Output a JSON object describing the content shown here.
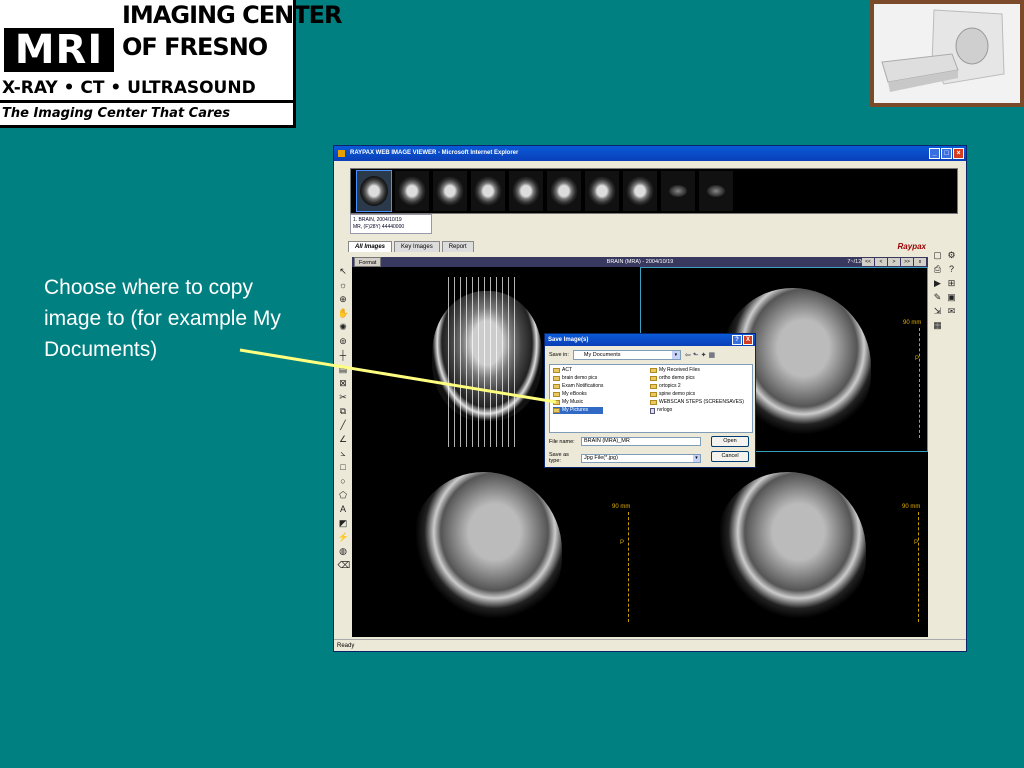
{
  "logo": {
    "mri": "MRI",
    "line1": "IMAGING CENTER",
    "line2": "OF FRESNO",
    "services": "X-RAY • CT • ULTRASOUND",
    "tagline": "The Imaging Center That Cares"
  },
  "caption": "Choose where to copy image to (for example My Documents)",
  "browser": {
    "title": "RAYPAX WEB IMAGE VIEWER - Microsoft Internet Explorer",
    "thumb_caption_line1": "1. BRAIN, 2004/10/19",
    "thumb_caption_line2": "MR, (F)28Y) 44440000",
    "tabs": [
      "All Images",
      "Key Images",
      "Report"
    ],
    "brand": "Raypax",
    "format_button": "Format",
    "viewer_title": "BRAIN (MRA) - 2004/10/19",
    "page_indicator": "7~/12(1)",
    "nav": [
      "<<",
      "<",
      ">",
      ">>",
      "x"
    ],
    "scale_label": "90 mm",
    "orientation_p": "P",
    "status": "Ready"
  },
  "dialog": {
    "title": "Save Image(s)",
    "help": "?",
    "close": "X",
    "save_in_label": "Save in:",
    "save_in_value": "My Documents",
    "left_items": [
      "ACT",
      "brain demo pics",
      "Exam Notifications",
      "My eBooks",
      "My Music",
      "My Pictures"
    ],
    "right_items": [
      "My Received Files",
      "ortho demo pics",
      "ortopics 2",
      "spine demo pics",
      "WEBSCAN STEPS (SCREENSAVES)",
      "rvrlogo"
    ],
    "file_name_label": "File name:",
    "file_name_value": "BRAIN (MRA)_MR",
    "save_type_label": "Save as type:",
    "save_type_value": "Jpg File(*.jpg)",
    "open_button": "Open",
    "cancel_button": "Cancel"
  }
}
